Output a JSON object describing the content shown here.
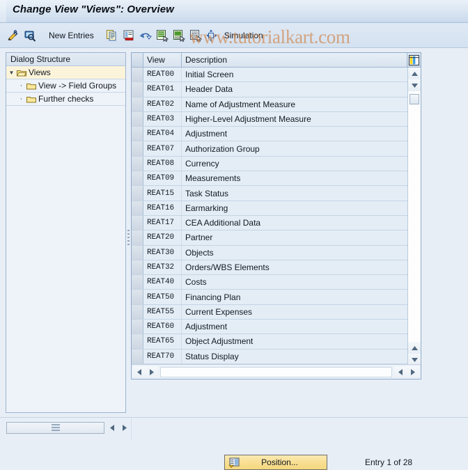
{
  "window": {
    "title": "Change View \"Views\": Overview"
  },
  "watermark": {
    "text": "www.tutorialkart.com",
    "color": "#d08a52"
  },
  "toolbar": {
    "icons_left": [
      {
        "name": "change-edit-icon",
        "label": "Display/Change"
      },
      {
        "name": "display-magnifier-icon",
        "label": "Display"
      }
    ],
    "new_entries_label": "New Entries",
    "icons_right": [
      {
        "name": "copy-as-icon",
        "label": "Copy As..."
      },
      {
        "name": "delete-row-icon",
        "label": "Delete"
      },
      {
        "name": "undo-icon",
        "label": "Undo Change"
      },
      {
        "name": "select-all-icon",
        "label": "Select All"
      },
      {
        "name": "select-block-icon",
        "label": "Select Block"
      },
      {
        "name": "deselect-all-icon",
        "label": "Deselect All"
      },
      {
        "name": "transport-icon",
        "label": "Transport"
      }
    ],
    "simulation_label": "Simulation"
  },
  "sidebar": {
    "header": "Dialog Structure",
    "items": [
      {
        "label": "Views",
        "level": 0,
        "expanded": true,
        "selected": true,
        "has_twisty": true
      },
      {
        "label": "View -> Field Groups",
        "level": 1,
        "expanded": false,
        "selected": false,
        "has_twisty": false
      },
      {
        "label": "Further checks",
        "level": 1,
        "expanded": false,
        "selected": false,
        "has_twisty": false
      }
    ]
  },
  "table": {
    "columns": [
      "View",
      "Description"
    ],
    "config_icon": "table-settings-icon",
    "rows": [
      {
        "view": "REAT00",
        "description": "Initial Screen"
      },
      {
        "view": "REAT01",
        "description": "Header Data"
      },
      {
        "view": "REAT02",
        "description": "Name of Adjustment Measure"
      },
      {
        "view": "REAT03",
        "description": "Higher-Level Adjustment Measure"
      },
      {
        "view": "REAT04",
        "description": "Adjustment"
      },
      {
        "view": "REAT07",
        "description": "Authorization Group"
      },
      {
        "view": "REAT08",
        "description": "Currency"
      },
      {
        "view": "REAT09",
        "description": "Measurements"
      },
      {
        "view": "REAT15",
        "description": "Task Status"
      },
      {
        "view": "REAT16",
        "description": "Earmarking"
      },
      {
        "view": "REAT17",
        "description": "CEA Additional Data"
      },
      {
        "view": "REAT20",
        "description": "Partner"
      },
      {
        "view": "REAT30",
        "description": "Objects"
      },
      {
        "view": "REAT32",
        "description": "Orders/WBS Elements"
      },
      {
        "view": "REAT40",
        "description": "Costs"
      },
      {
        "view": "REAT50",
        "description": "Financing Plan"
      },
      {
        "view": "REAT55",
        "description": "Current Expenses"
      },
      {
        "view": "REAT60",
        "description": "Adjustment"
      },
      {
        "view": "REAT65",
        "description": "Object Adjustment"
      },
      {
        "view": "REAT70",
        "description": "Status Display"
      }
    ]
  },
  "footer": {
    "position_button_label": "Position...",
    "position_icon": "position-icon",
    "entry_count": "Entry 1 of 28"
  }
}
